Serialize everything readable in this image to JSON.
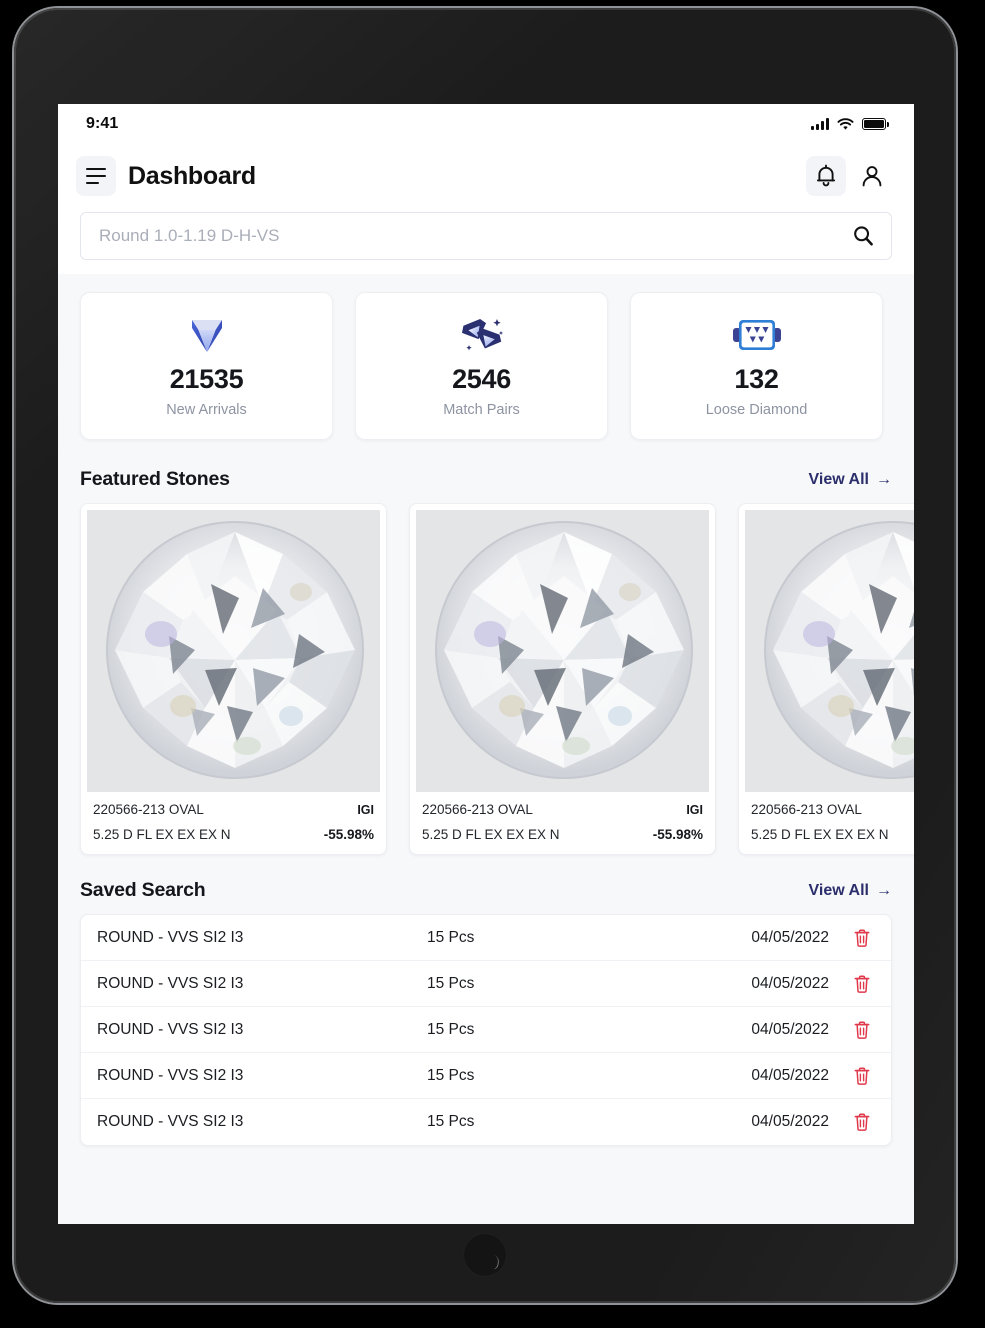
{
  "device": {
    "type": "tablet",
    "home_button": "home-button"
  },
  "status_bar": {
    "time": "9:41",
    "icons": [
      "cellular-signal-icon",
      "wifi-icon",
      "battery-icon"
    ]
  },
  "app_bar": {
    "menu_icon": "hamburger-menu-icon",
    "title": "Dashboard",
    "actions": [
      {
        "name": "notification-bell-icon",
        "label": "Notifications"
      },
      {
        "name": "user-profile-icon",
        "label": "Profile"
      }
    ]
  },
  "search": {
    "placeholder": "Round 1.0-1.19 D-H-VS",
    "value": "",
    "icon": "search-icon"
  },
  "stats": [
    {
      "icon": "diamond-icon",
      "value": "21535",
      "label": "New Arrivals"
    },
    {
      "icon": "paired-diamonds-icon",
      "value": "2546",
      "label": "Match Pairs"
    },
    {
      "icon": "diamond-tray-icon",
      "value": "132",
      "label": "Loose Diamond"
    }
  ],
  "featured_stones": {
    "title": "Featured Stones",
    "view_all": "View All",
    "arrow": "→",
    "cards": [
      {
        "id": "220566-213 OVAL",
        "lab": "IGI",
        "spec": "5.25 D FL EX EX EX N",
        "discount": "-55.98%"
      },
      {
        "id": "220566-213 OVAL",
        "lab": "IGI",
        "spec": "5.25 D FL EX EX EX N",
        "discount": "-55.98%"
      },
      {
        "id": "220566-213 OVAL",
        "lab": "",
        "spec": "5.25 D FL EX EX EX N",
        "discount": ""
      }
    ]
  },
  "saved_search": {
    "title": "Saved Search",
    "view_all": "View All",
    "arrow": "→",
    "delete_icon": "trash-icon",
    "rows": [
      {
        "name": "ROUND - VVS SI2 I3",
        "pcs": "15 Pcs",
        "date": "04/05/2022"
      },
      {
        "name": "ROUND - VVS SI2 I3",
        "pcs": "15 Pcs",
        "date": "04/05/2022"
      },
      {
        "name": "ROUND - VVS SI2 I3",
        "pcs": "15 Pcs",
        "date": "04/05/2022"
      },
      {
        "name": "ROUND - VVS SI2 I3",
        "pcs": "15 Pcs",
        "date": "04/05/2022"
      },
      {
        "name": "ROUND - VVS SI2 I3",
        "pcs": "15 Pcs",
        "date": "04/05/2022"
      }
    ]
  },
  "colors": {
    "accent_navy": "#2c2f6b",
    "icon_blue": "#3e5ad0",
    "delete_red": "#e0394b",
    "page_bg": "#f7f8fa",
    "text_primary": "#16181d",
    "text_muted": "#8d93a1"
  }
}
